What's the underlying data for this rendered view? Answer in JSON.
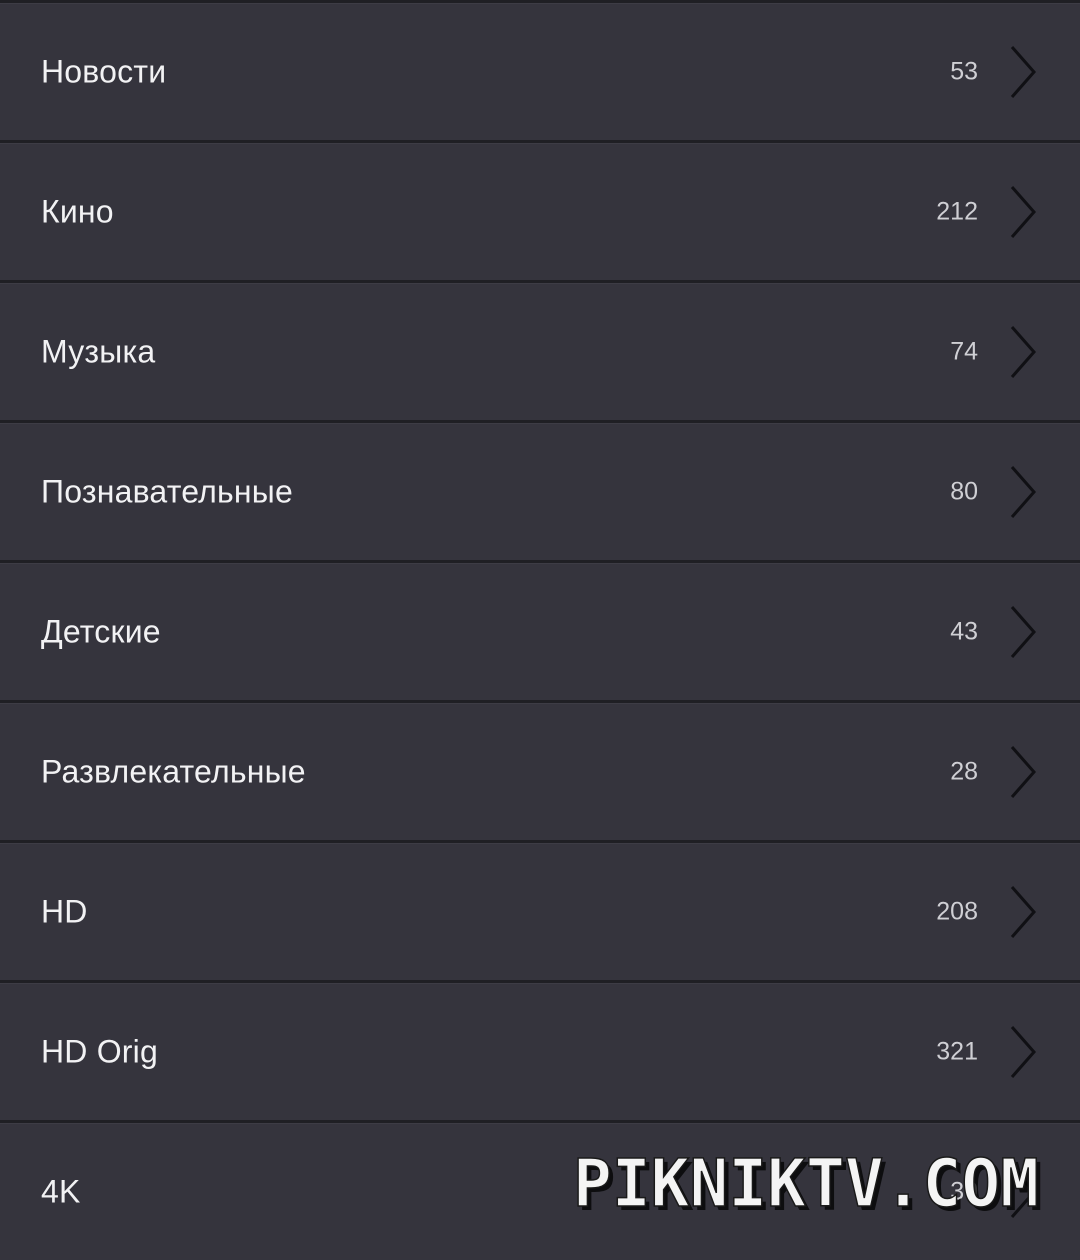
{
  "categories": [
    {
      "label": "Новости",
      "count": "53"
    },
    {
      "label": "Кино",
      "count": "212"
    },
    {
      "label": "Музыка",
      "count": "74"
    },
    {
      "label": "Познавательные",
      "count": "80"
    },
    {
      "label": "Детские",
      "count": "43"
    },
    {
      "label": "Развлекательные",
      "count": "28"
    },
    {
      "label": "HD",
      "count": "208"
    },
    {
      "label": "HD Orig",
      "count": "321"
    },
    {
      "label": "4K",
      "count": "30"
    }
  ],
  "watermark": {
    "text": "PIKNIKTV.COM"
  },
  "icons": {
    "row_chevron": "chevron-right-icon"
  },
  "colors": {
    "row_background": "#35343d",
    "separator": "#1f1f24",
    "label_text": "#f2f2f4",
    "count_text": "#cfcfd4",
    "chevron": "#101014"
  }
}
